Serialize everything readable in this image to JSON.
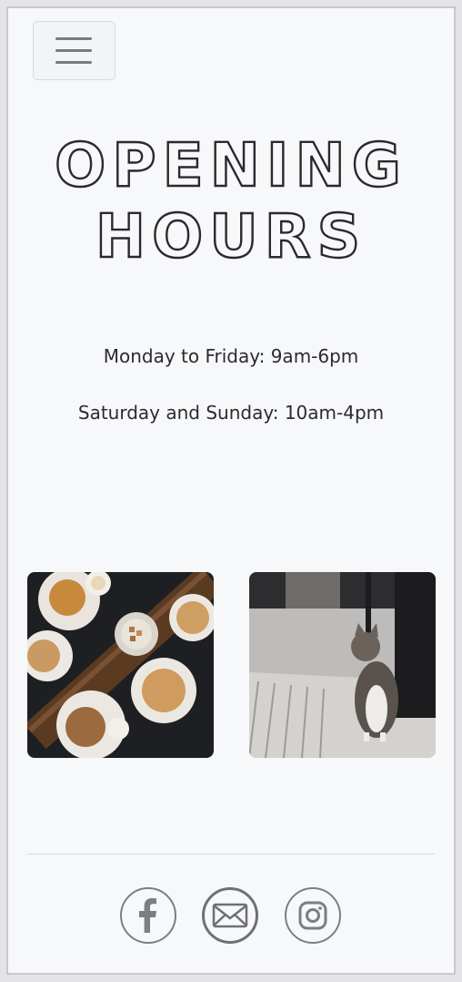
{
  "nav": {
    "menu_icon": "hamburger-menu-icon"
  },
  "heading": {
    "line1": "OPENING",
    "line2": "HOURS"
  },
  "hours": {
    "weekday": "Monday to Friday: 9am-6pm",
    "weekend": "Saturday and Sunday: 10am-4pm"
  },
  "gallery": {
    "photo1_icon": "coffee-and-pastries-photo",
    "photo2_icon": "cat-on-sidewalk-photo"
  },
  "social": {
    "icons": [
      "facebook-icon",
      "email-icon",
      "instagram-icon"
    ],
    "color": "#7d7e82"
  },
  "colors": {
    "background": "#f7f8fa",
    "text": "#2b2b2d"
  }
}
